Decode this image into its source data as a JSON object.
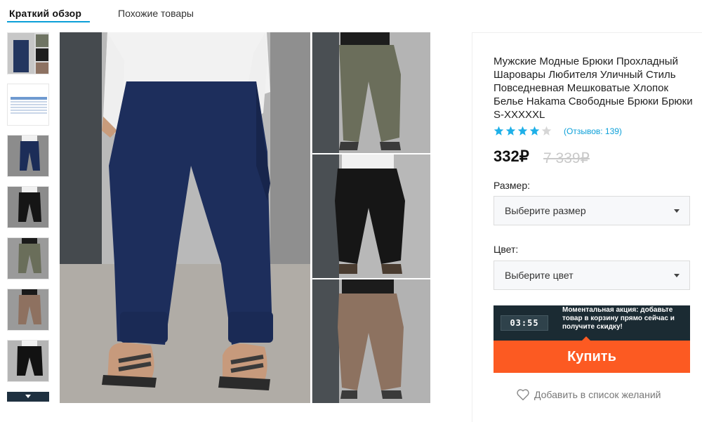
{
  "tabs": {
    "overview": "Краткий обзор",
    "similar": "Похожие товары"
  },
  "product": {
    "title": "Мужские Модные Брюки Прохладный Шаровары Любителя Уличный Стиль Повседневная Мешковатые Хлопок Белье Hakama Свободные Брюки Брюки S-XXXXXL",
    "rating": 4,
    "rating_max": 5,
    "reviews": "(Отзывов: 139)",
    "price": "332₽",
    "old_price": "7 339₽"
  },
  "size": {
    "label": "Размер:",
    "placeholder": "Выберите размер"
  },
  "color": {
    "label": "Цвет:",
    "placeholder": "Выберите цвет"
  },
  "promo": {
    "timer": "03:55",
    "text": "Моментальная акция: добавьте товар в корзину прямо сейчас и получите скидку!"
  },
  "buy_label": "Купить",
  "wishlist_label": "Добавить в список желаний",
  "icons": {
    "star": "star-icon",
    "heart": "heart-icon",
    "caret": "chevron-down-icon"
  },
  "colors": {
    "accent": "#0b9fd8",
    "buy": "#fc5a22",
    "promo_bg": "#1b2b33",
    "star_filled": "#1fb0e8",
    "star_empty": "#d6d6d6"
  }
}
